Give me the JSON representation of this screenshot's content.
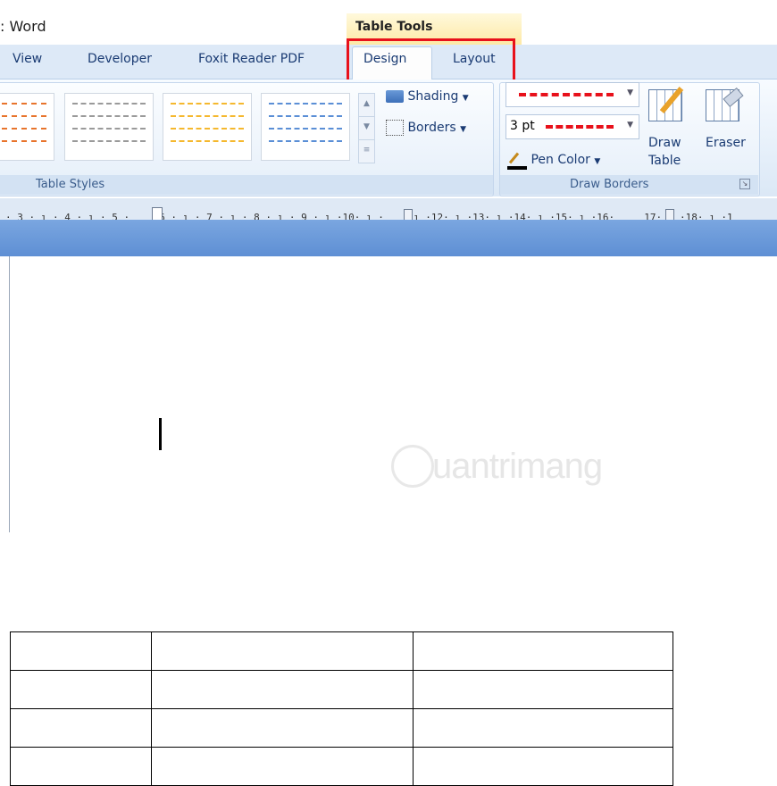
{
  "window": {
    "title": ": Word"
  },
  "contextual": {
    "label": "Table Tools"
  },
  "tabs": [
    {
      "label": "View"
    },
    {
      "label": "Developer"
    },
    {
      "label": "Foxit Reader PDF"
    },
    {
      "label": "Design",
      "active": true
    },
    {
      "label": "Layout"
    }
  ],
  "ribbon": {
    "table_styles": {
      "group_label": "Table Styles",
      "swatch_colors": [
        "#e8742c",
        "#9a9a9a",
        "#f5b82e",
        "#5b8fd6"
      ],
      "shading_label": "Shading",
      "borders_label": "Borders"
    },
    "draw_borders": {
      "group_label": "Draw Borders",
      "line_weight": "3 pt",
      "pen_color_label": "Pen Color",
      "pen_color": "#e8111b",
      "draw_table_label_1": "Draw",
      "draw_table_label_2": "Table",
      "eraser_label": "Eraser"
    }
  },
  "ruler": {
    "text": "· 3 · ı · 4 · ı · 5 ·     6 · ı · 7 · ı · 8 · ı · 9 · ı ·10· ı ·     ı ·12· ı ·13· ı ·14· ı ·15· ı ·16·     17· ı ·18· ı ·1"
  },
  "document": {
    "table": {
      "rows": 4,
      "cols": 3
    },
    "watermark": "uantrimang"
  },
  "highlight_color": "#e8111b"
}
